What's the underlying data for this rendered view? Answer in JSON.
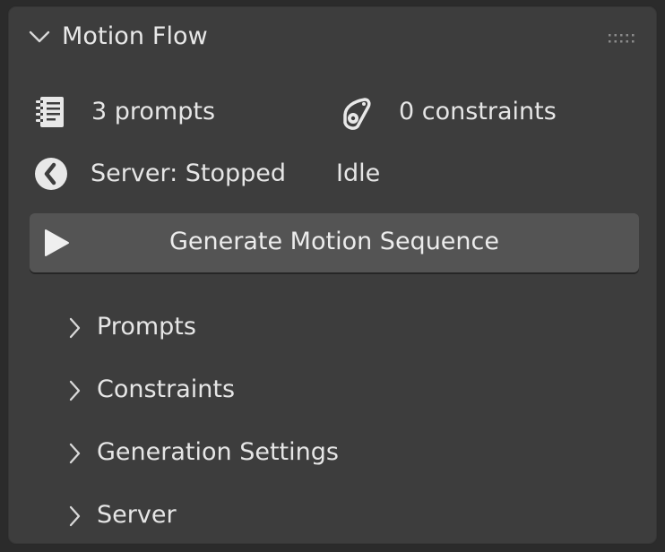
{
  "panel": {
    "title": "Motion Flow",
    "icons": {
      "collapse": "chevron-down-icon",
      "drag": "drag-handle-icon"
    }
  },
  "stats": {
    "prompts_text": "3 prompts",
    "constraints_text": "0 constraints",
    "server_text": "Server: Stopped",
    "status_text": "Idle"
  },
  "actions": {
    "generate_label": "Generate Motion Sequence"
  },
  "subpanels": [
    {
      "label": "Prompts"
    },
    {
      "label": "Constraints"
    },
    {
      "label": "Generation Settings"
    },
    {
      "label": "Server"
    }
  ],
  "colors": {
    "background": "#2b2b2b",
    "panel": "#3d3d3d",
    "button": "#545454",
    "text": "#e6e6e6"
  }
}
